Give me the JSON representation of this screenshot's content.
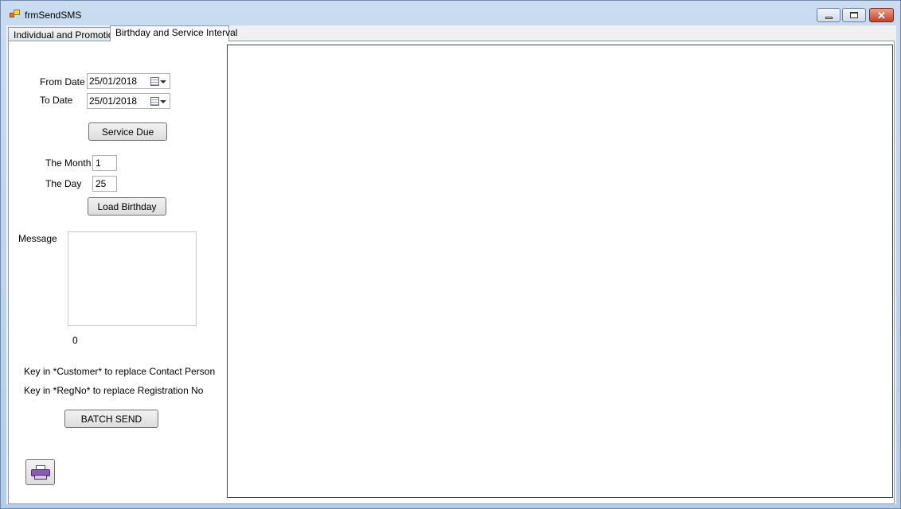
{
  "window": {
    "title": "frmSendSMS",
    "controls": {
      "minimize": "minimize",
      "maximize": "maximize",
      "close": "✕"
    }
  },
  "tabs": [
    {
      "label": "Individual and Promotion",
      "active": false
    },
    {
      "label": "Birthday and Service Interval",
      "active": true
    }
  ],
  "form": {
    "from_date_label": "From Date",
    "from_date_value": "25/01/2018",
    "to_date_label": "To Date",
    "to_date_value": "25/01/2018",
    "service_due_button": "Service Due",
    "month_label": "The Month",
    "month_value": "1",
    "day_label": "The Day",
    "day_value": "25",
    "load_birthday_button": "Load Birthday",
    "message_label": "Message",
    "message_value": "",
    "char_count": "0",
    "hint_customer": "Key in *Customer* to replace Contact Person",
    "hint_regno": "Key in *RegNo* to replace Registration No",
    "batch_send_button": "BATCH SEND",
    "print_icon": "printer-icon"
  },
  "colors": {
    "titlebar": "#c9dcf1",
    "close_button": "#c2412b",
    "tab_page": "#ffffff"
  }
}
